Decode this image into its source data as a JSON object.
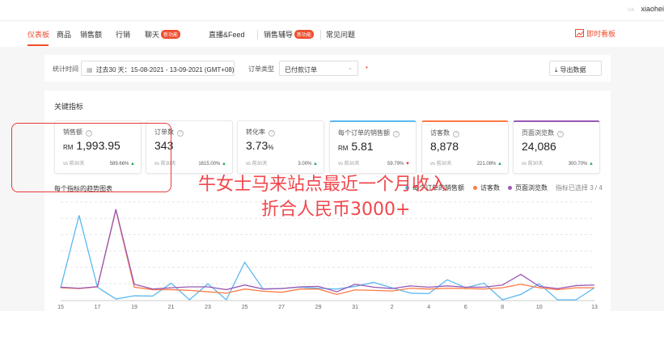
{
  "topbar": {
    "user_icon": "UK",
    "username": "xiaohei"
  },
  "nav": {
    "items": [
      {
        "label": "仪表板",
        "active": true
      },
      {
        "label": "商品"
      },
      {
        "label": "销售额"
      },
      {
        "label": "行销"
      },
      {
        "label": "聊天",
        "badge": "新功能"
      },
      {
        "label": "直播&Feed"
      },
      {
        "label": "销售辅导",
        "badge": "新功能"
      },
      {
        "label": "常见问题"
      }
    ],
    "live_label": "即时看板",
    "accent": "#ee4d2d"
  },
  "filter": {
    "time_label": "统计时间",
    "time_value": "过去30 天：15-08-2021 - 13-09-2021 (GMT+08)",
    "order_type_label": "订单类型",
    "order_type_value": "已付款订单",
    "export_label": "导出数据"
  },
  "metrics": {
    "title": "关键指标",
    "items": [
      {
        "label": "销售额",
        "prefix": "RM",
        "value": "1,993.95",
        "vs": "vs 前30天",
        "change": "589.66%",
        "dir": "up"
      },
      {
        "label": "订单数",
        "prefix": "",
        "value": "343",
        "vs": "vs 前30天",
        "change": "1615.00%",
        "dir": "up"
      },
      {
        "label": "转化率",
        "prefix": "",
        "value": "3.73",
        "suffix": "%",
        "vs": "vs 前30天",
        "change": "3.00%",
        "dir": "up"
      },
      {
        "label": "每个订单的销售额",
        "prefix": "RM",
        "value": "5.81",
        "vs": "vs 前30天",
        "change": "59.79%",
        "dir": "down",
        "color": "#5bb8f0"
      },
      {
        "label": "访客数",
        "prefix": "",
        "value": "8,878",
        "vs": "vs 前30天",
        "change": "221.08%",
        "dir": "up",
        "color": "#ff7a45"
      },
      {
        "label": "页面浏览数",
        "prefix": "",
        "value": "24,086",
        "vs": "vs 前30天",
        "change": "300.70%",
        "dir": "up",
        "color": "#9b59b6"
      }
    ]
  },
  "chart_data": {
    "type": "line",
    "title": "每个指标的趋势图表",
    "selected_note": "指标已选择 3 / 4",
    "x": [
      "15",
      "16",
      "17",
      "18",
      "19",
      "20",
      "21",
      "22",
      "23",
      "24",
      "25",
      "26",
      "27",
      "28",
      "29",
      "30",
      "31",
      "1",
      "2",
      "3",
      "4",
      "5",
      "6",
      "7",
      "8",
      "9",
      "10",
      "11",
      "12",
      "13"
    ],
    "x_tick_labels": [
      "15",
      "17",
      "19",
      "21",
      "23",
      "25",
      "27",
      "29",
      "31",
      "2",
      "4",
      "6",
      "8",
      "10",
      "13"
    ],
    "grid": true,
    "legend": "top-right",
    "series": [
      {
        "name": "每个订单的销售额",
        "color": "#5bb8f0",
        "values": [
          12.3,
          86.3,
          12.9,
          0.8,
          4.1,
          3.8,
          17,
          0,
          16.4,
          0,
          38.4,
          11,
          11.5,
          12.9,
          11.8,
          11,
          13.7,
          17.8,
          12.3,
          6.8,
          6.3,
          20.5,
          12.3,
          17,
          0,
          5.5,
          16.4,
          0,
          0,
          12.3
        ]
      },
      {
        "name": "访客数",
        "color": "#ff7a45",
        "values": [
          12.3,
          11.5,
          13.2,
          91.8,
          12.9,
          10.4,
          10.4,
          9.6,
          8.2,
          6.8,
          11,
          8.8,
          7.7,
          11,
          11,
          5.5,
          10.1,
          9.6,
          9,
          11.8,
          11,
          11.8,
          11.5,
          11,
          12.3,
          15.9,
          12.3,
          10.4,
          12.3,
          12.3
        ]
      },
      {
        "name": "页面浏览数",
        "color": "#9b59b6",
        "values": [
          12.9,
          11.8,
          13.4,
          92.6,
          15.9,
          11,
          12.3,
          13.2,
          13.2,
          10.4,
          15.1,
          11,
          11.5,
          13.2,
          13.7,
          8.2,
          15.9,
          12.9,
          11.5,
          14.2,
          12.9,
          14.2,
          12.9,
          12.9,
          15.1,
          26,
          13.7,
          11.5,
          14.5,
          15.1
        ]
      }
    ]
  },
  "annotation": {
    "line1": "牛女士马来站点最近一个月收入",
    "line2": "折合人民币3000+",
    "color": "#f0484d"
  }
}
